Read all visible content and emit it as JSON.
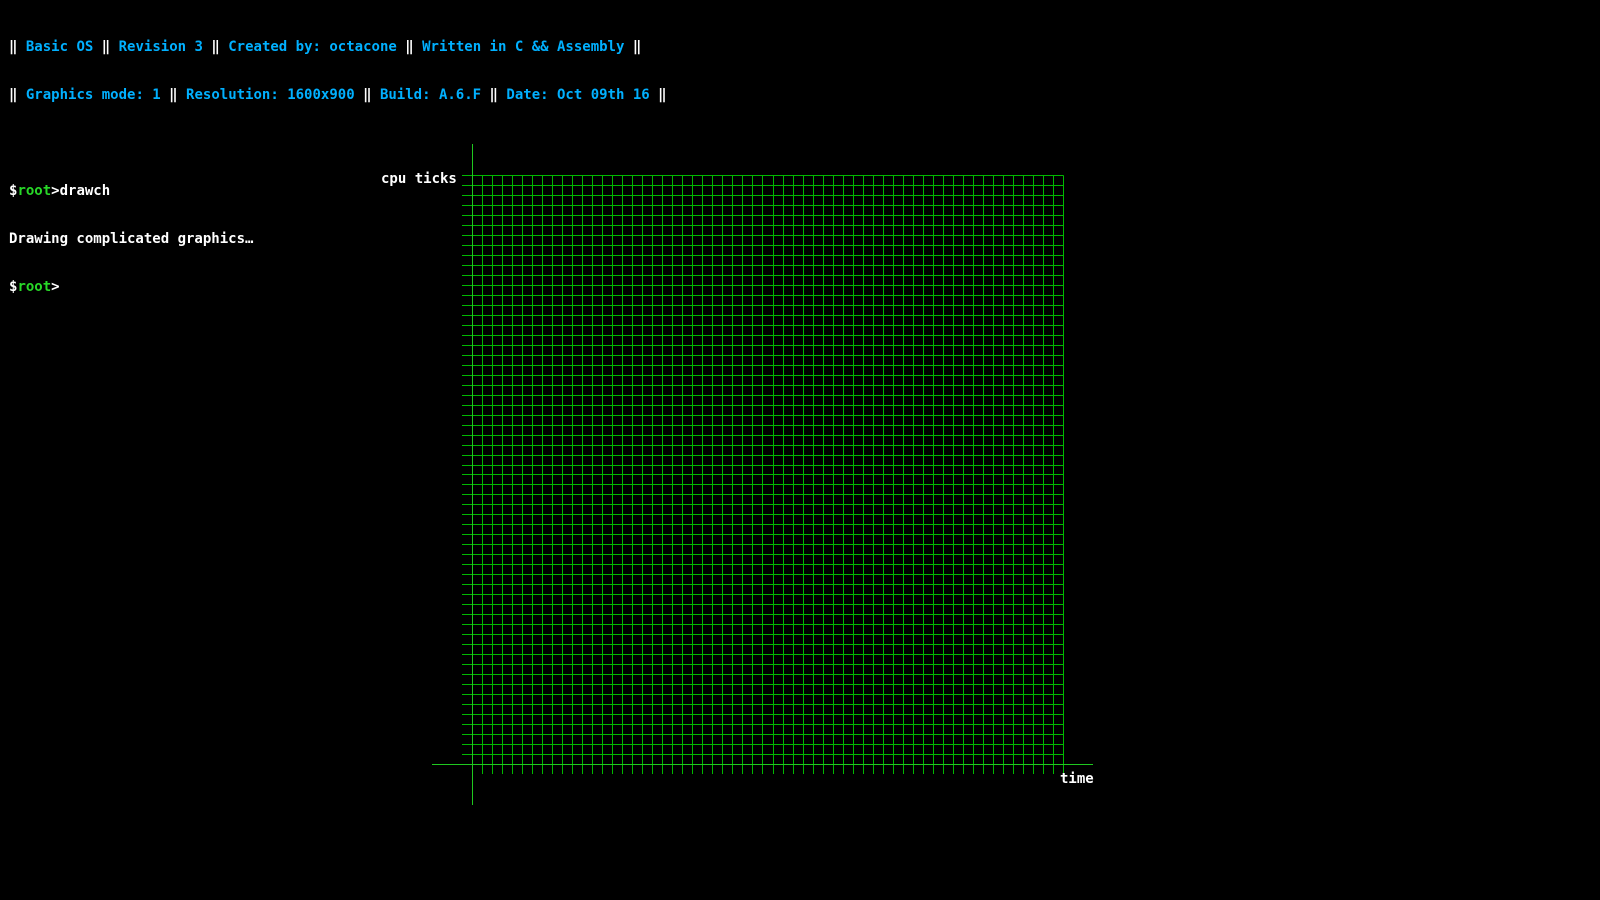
{
  "header": {
    "separator": "‖",
    "line1": [
      "Basic OS",
      "Revision 3",
      "Created by: octacone",
      "Written in C && Assembly"
    ],
    "line2": [
      "Graphics mode: 1",
      "Resolution: 1600x900",
      "Build: A.6.F",
      "Date: Oct 09th 16"
    ]
  },
  "session": {
    "prompt_prefix": "$",
    "prompt_user": "root",
    "prompt_suffix": ">",
    "command": "drawch",
    "output": "Drawing complicated graphics…"
  },
  "chart_data": {
    "type": "line",
    "ylabel": "cpu ticks",
    "xlabel": "time",
    "grid": true,
    "series": [],
    "grid_columns": 59,
    "grid_rows": 59
  },
  "colors": {
    "background": "#000000",
    "text": "#ffffff",
    "info": "#00b0ff",
    "prompt_user": "#28d828",
    "grid": "#00b800",
    "axis": "#1fc81f"
  }
}
